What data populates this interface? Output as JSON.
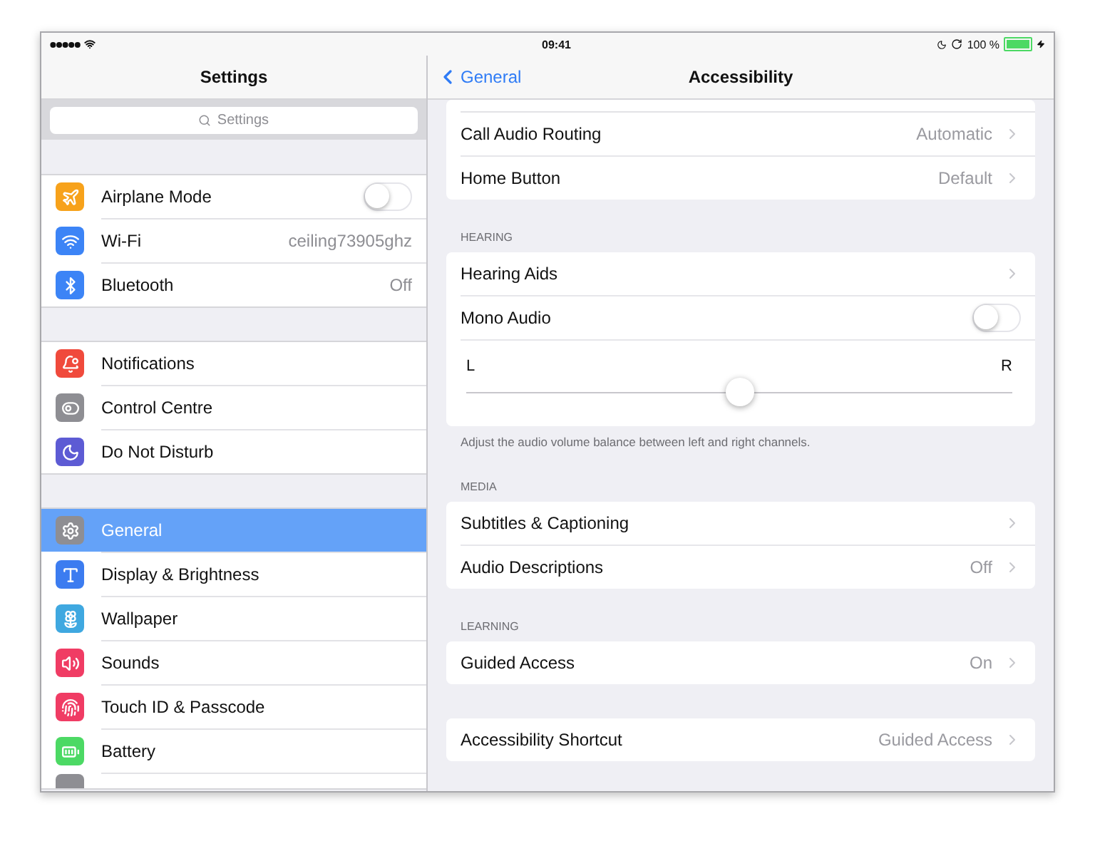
{
  "status_bar": {
    "time": "09:41",
    "battery_text": "100 %"
  },
  "sidebar": {
    "title": "Settings",
    "search": {
      "placeholder": "Settings"
    },
    "groups": [
      {
        "items": [
          {
            "label": "Airplane Mode",
            "kind": "toggle",
            "on": false,
            "selected": false
          },
          {
            "label": "Wi-Fi",
            "kind": "value",
            "value": "ceiling73905ghz",
            "selected": false
          },
          {
            "label": "Bluetooth",
            "kind": "value",
            "value": "Off",
            "selected": false
          }
        ]
      },
      {
        "items": [
          {
            "label": "Notifications",
            "kind": "plain",
            "selected": false
          },
          {
            "label": "Control Centre",
            "kind": "plain",
            "selected": false
          },
          {
            "label": "Do Not Disturb",
            "kind": "plain",
            "selected": false
          }
        ]
      },
      {
        "items": [
          {
            "label": "General",
            "kind": "plain",
            "selected": true
          },
          {
            "label": "Display & Brightness",
            "kind": "plain",
            "selected": false
          },
          {
            "label": "Wallpaper",
            "kind": "plain",
            "selected": false
          },
          {
            "label": "Sounds",
            "kind": "plain",
            "selected": false
          },
          {
            "label": "Touch ID & Passcode",
            "kind": "plain",
            "selected": false
          },
          {
            "label": "Battery",
            "kind": "plain",
            "selected": false
          }
        ]
      }
    ]
  },
  "detail": {
    "back": "General",
    "title": "Accessibility",
    "sections": [
      {
        "rows": [
          {
            "kind": "link",
            "label": "Call Audio Routing",
            "value": "Automatic"
          },
          {
            "kind": "link",
            "label": "Home Button",
            "value": "Default"
          }
        ],
        "cut_top": true
      },
      {
        "header": "HEARING",
        "rows": [
          {
            "kind": "link",
            "label": "Hearing Aids"
          },
          {
            "kind": "toggle",
            "label": "Mono Audio",
            "on": false
          },
          {
            "kind": "slider",
            "left": "L",
            "right": "R",
            "level": 0.5
          }
        ],
        "footer": "Adjust the audio volume balance between left and right channels."
      },
      {
        "header": "MEDIA",
        "rows": [
          {
            "kind": "link",
            "label": "Subtitles & Captioning"
          },
          {
            "kind": "link",
            "label": "Audio Descriptions",
            "value": "Off"
          }
        ]
      },
      {
        "header": "LEARNING",
        "rows": [
          {
            "kind": "link",
            "label": "Guided Access",
            "value": "On"
          }
        ]
      },
      {
        "rows": [
          {
            "kind": "link",
            "label": "Accessibility Shortcut",
            "value": "Guided Access"
          }
        ]
      }
    ]
  }
}
